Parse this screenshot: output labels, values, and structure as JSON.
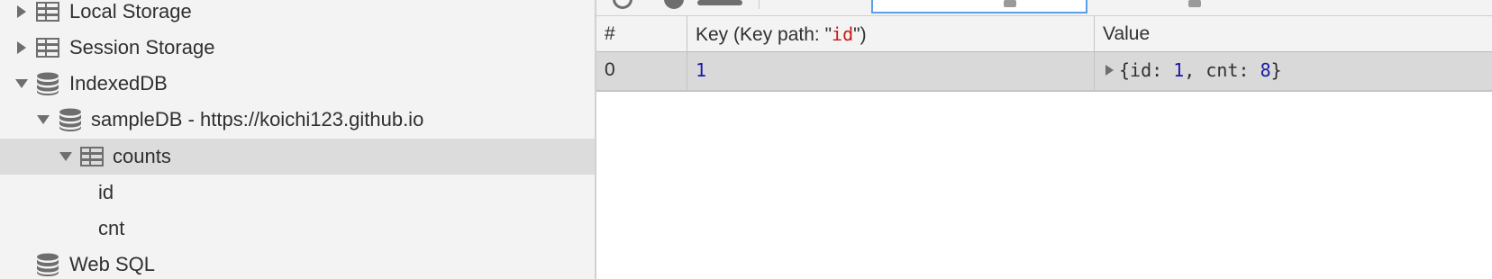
{
  "tree": {
    "items": [
      {
        "label": "Local Storage",
        "icon": "table-grid-icon",
        "expanded": false
      },
      {
        "label": "Session Storage",
        "icon": "table-grid-icon",
        "expanded": false
      },
      {
        "label": "IndexedDB",
        "icon": "database-icon",
        "expanded": true
      },
      {
        "label": "sampleDB - https://koichi123.github.io",
        "icon": "database-icon",
        "expanded": true
      },
      {
        "label": "counts",
        "icon": "table-grid-icon",
        "expanded": true,
        "selected": true
      },
      {
        "label": "id"
      },
      {
        "label": "cnt"
      },
      {
        "label": "Web SQL",
        "icon": "database-icon"
      }
    ]
  },
  "grid": {
    "headers": {
      "num": "#",
      "key_prefix": "Key (Key path: \"",
      "key_path": "id",
      "key_suffix": "\")",
      "value": "Value"
    },
    "rows": [
      {
        "num": "0",
        "key": "1",
        "value": {
          "open": "{",
          "k1": "id",
          "sep1": ": ",
          "v1": "1",
          "comma": ", ",
          "k2": "cnt",
          "sep2": ": ",
          "v2": "8",
          "close": "}"
        }
      }
    ]
  },
  "colors": {
    "selected_row": "#dcdcdc",
    "panel_bg": "#f3f3f3",
    "key_path_red": "#c41a16",
    "number_blue": "#1a1aa6",
    "input_focus_blue": "#5a9fe8"
  }
}
